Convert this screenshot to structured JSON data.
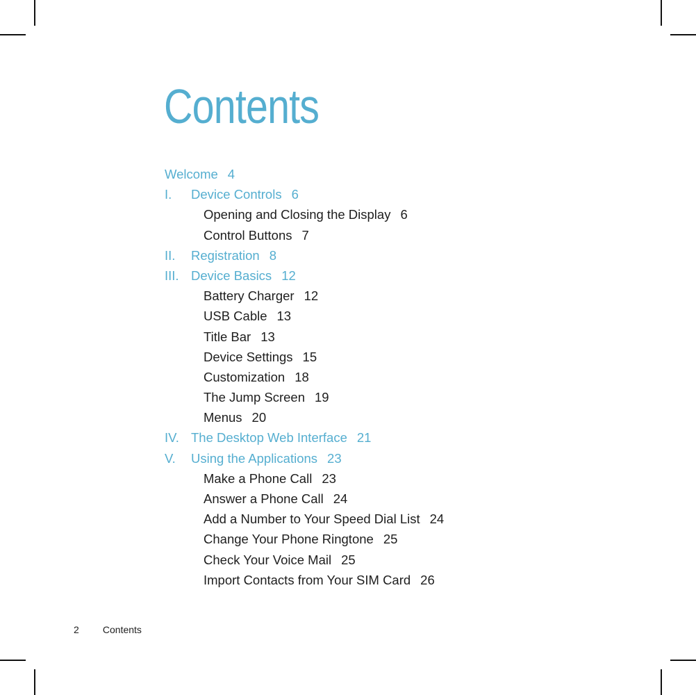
{
  "title": "Contents",
  "accent_color": "#55aed0",
  "toc": [
    {
      "type": "chapter",
      "num": "",
      "label": "Welcome",
      "page": "4"
    },
    {
      "type": "chapter",
      "num": "I.",
      "label": "Device Controls",
      "page": "6"
    },
    {
      "type": "section",
      "label": "Opening and Closing the Display",
      "page": "6"
    },
    {
      "type": "section",
      "label": "Control Buttons",
      "page": "7"
    },
    {
      "type": "chapter",
      "num": "II.",
      "label": "Registration",
      "page": "8"
    },
    {
      "type": "chapter",
      "num": "III.",
      "label": "Device Basics",
      "page": "12"
    },
    {
      "type": "section",
      "label": "Battery Charger",
      "page": "12"
    },
    {
      "type": "section",
      "label": "USB Cable",
      "page": "13"
    },
    {
      "type": "section",
      "label": "Title Bar",
      "page": "13"
    },
    {
      "type": "section",
      "label": "Device Settings",
      "page": "15"
    },
    {
      "type": "section",
      "label": "Customization",
      "page": "18"
    },
    {
      "type": "section",
      "label": "The Jump Screen",
      "page": "19"
    },
    {
      "type": "section",
      "label": "Menus",
      "page": "20"
    },
    {
      "type": "chapter",
      "num": "IV.",
      "label": "The Desktop Web Interface",
      "page": "21"
    },
    {
      "type": "chapter",
      "num": "V.",
      "label": "Using the Applications",
      "page": "23"
    },
    {
      "type": "section",
      "label": "Make a Phone Call",
      "page": "23"
    },
    {
      "type": "section",
      "label": "Answer a Phone Call",
      "page": "24"
    },
    {
      "type": "section",
      "label": "Add a Number to Your Speed Dial List",
      "page": "24"
    },
    {
      "type": "section",
      "label": "Change Your Phone Ringtone",
      "page": "25"
    },
    {
      "type": "section",
      "label": "Check Your Voice Mail",
      "page": "25"
    },
    {
      "type": "section",
      "label": "Import Contacts from Your SIM Card",
      "page": "26"
    }
  ],
  "footer": {
    "page_number": "2",
    "section": "Contents"
  }
}
